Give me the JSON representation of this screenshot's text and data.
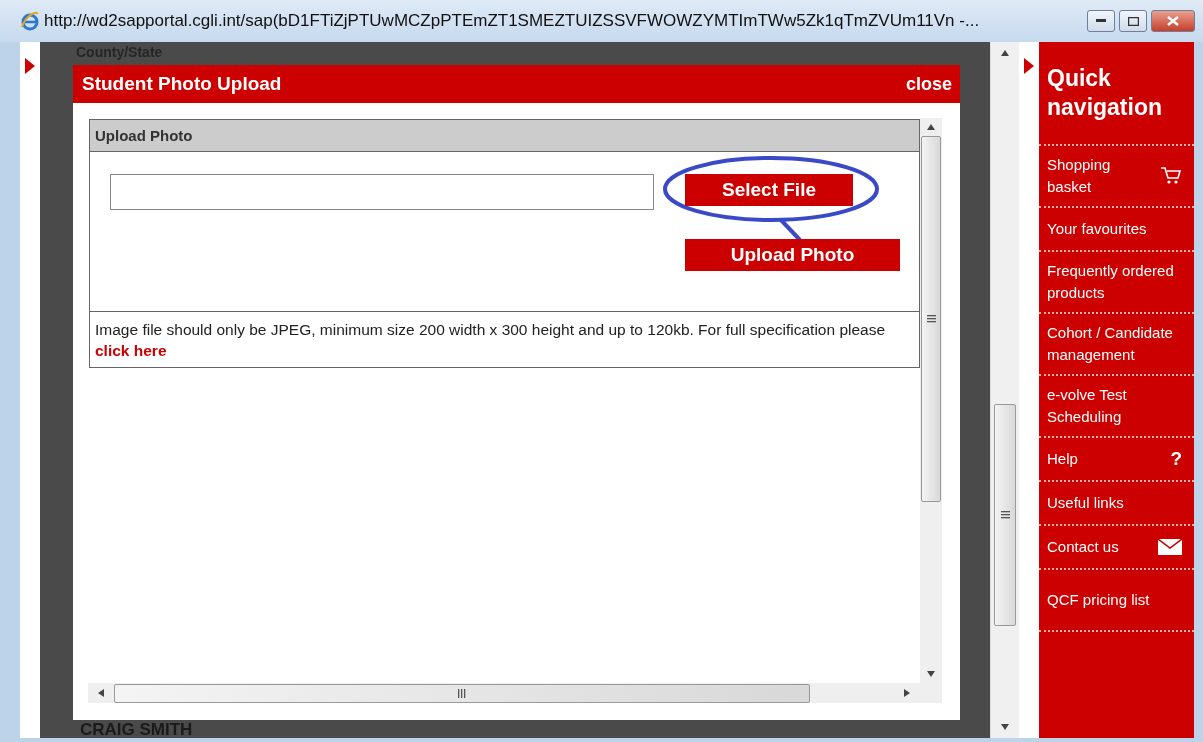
{
  "window": {
    "title": "http://wd2sapportal.cgli.int/sap(bD1FTiZjPTUwMCZpPTEmZT1SMEZTUIZSSVFWOWZYMTImTWw5Zk1qTmZVUm11Vn -..."
  },
  "background": {
    "labels": [
      "County/State",
      "CRAIG SMITH"
    ]
  },
  "dialog": {
    "title": "Student Photo Upload",
    "close": "close",
    "section": {
      "title": "Upload Photo",
      "buttons": [
        {
          "label": "Select File",
          "highlighted": true
        },
        {
          "label": "Upload Photo",
          "highlighted": false
        }
      ],
      "note": {
        "text": "Image file should only be JPEG, minimum size 200 width x 300 height and up to 120kb. For full specification please",
        "link": "click here"
      }
    }
  },
  "quick_nav": {
    "title": "Quick navigation",
    "items": [
      {
        "label": "Shopping basket",
        "kind": "cart"
      },
      {
        "label": "Your favourites",
        "kind": "plain"
      },
      {
        "label": "Frequently ordered products",
        "kind": "plain"
      },
      {
        "label": "Cohort / Candidate management",
        "kind": "plain"
      },
      {
        "label": "e-volve Test Scheduling",
        "kind": "plain"
      },
      {
        "label": "Help",
        "kind": "glyph",
        "glyph": "?"
      },
      {
        "label": "Useful links",
        "kind": "plain"
      },
      {
        "label": "Contact us",
        "kind": "mail"
      },
      {
        "label": "QCF pricing list",
        "kind": "plain"
      }
    ]
  }
}
